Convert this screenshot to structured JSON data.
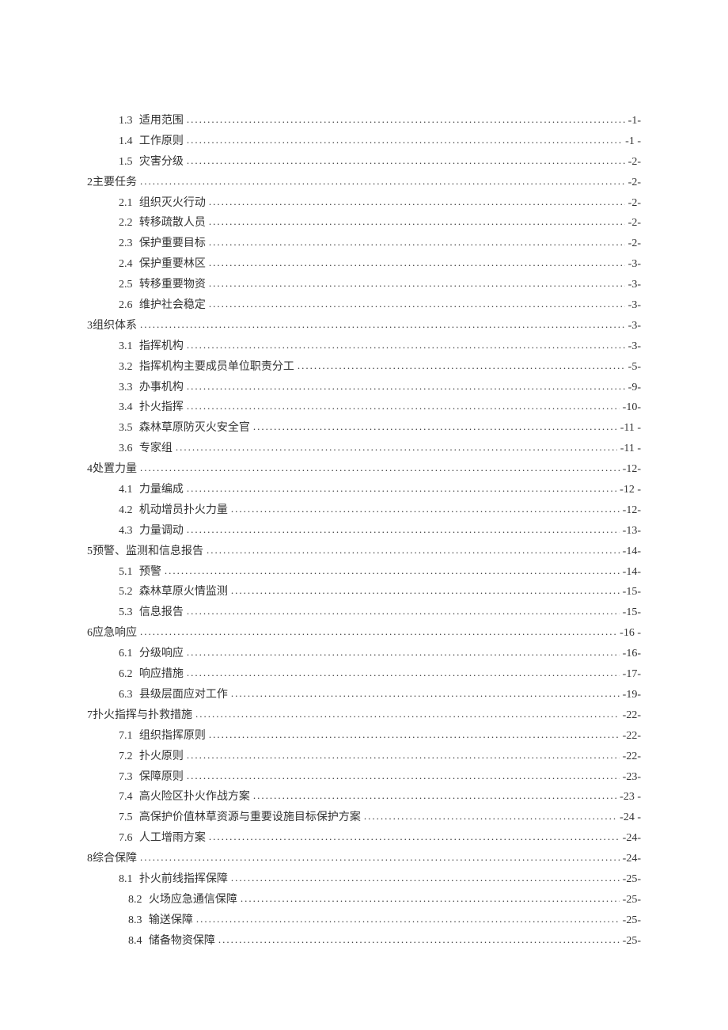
{
  "entries": [
    {
      "num": "1.3",
      "title": "适用范围",
      "page": "-1-",
      "indent": 1,
      "spaced": true
    },
    {
      "num": "1.4",
      "title": "工作原则",
      "page": "-1 -",
      "indent": 1,
      "spaced": true
    },
    {
      "num": "1.5",
      "title": "灾害分级",
      "page": "-2-",
      "indent": 1,
      "spaced": true
    },
    {
      "num": "2",
      "title": "主要任务",
      "page": "-2-",
      "indent": 0,
      "spaced": false
    },
    {
      "num": "2.1",
      "title": "组织灭火行动",
      "page": "-2-",
      "indent": 1,
      "spaced": true
    },
    {
      "num": "2.2",
      "title": "转移疏散人员",
      "page": "-2-",
      "indent": 1,
      "spaced": true
    },
    {
      "num": "2.3",
      "title": "保护重要目标",
      "page": "-2-",
      "indent": 1,
      "spaced": true
    },
    {
      "num": "2.4",
      "title": "保护重要林区",
      "page": "-3-",
      "indent": 1,
      "spaced": true
    },
    {
      "num": "2.5",
      "title": "转移重要物资",
      "page": "-3-",
      "indent": 1,
      "spaced": true
    },
    {
      "num": "2.6",
      "title": "维护社会稳定",
      "page": "-3-",
      "indent": 1,
      "spaced": true
    },
    {
      "num": "3",
      "title": "组织体系",
      "page": "-3-",
      "indent": 0,
      "spaced": false
    },
    {
      "num": "3.1",
      "title": "指挥机构",
      "page": "-3-",
      "indent": 1,
      "spaced": true
    },
    {
      "num": "3.2",
      "title": "指挥机构主要成员单位职责分工",
      "page": "-5-",
      "indent": 1,
      "spaced": true
    },
    {
      "num": "3.3",
      "title": "办事机构",
      "page": "-9-",
      "indent": 1,
      "spaced": true
    },
    {
      "num": "3.4",
      "title": "扑火指挥",
      "page": "-10-",
      "indent": 1,
      "spaced": true
    },
    {
      "num": "3.5",
      "title": "森林草原防灭火安全官",
      "page": "-11  -",
      "indent": 1,
      "spaced": true
    },
    {
      "num": "3.6",
      "title": "专家组",
      "page": "-11 -",
      "indent": 1,
      "spaced": true
    },
    {
      "num": "4",
      "title": "处置力量",
      "page": "-12-",
      "indent": 0,
      "spaced": false
    },
    {
      "num": "4.1",
      "title": "力量编成",
      "page": "-12 -",
      "indent": 1,
      "spaced": true
    },
    {
      "num": "4.2",
      "title": "机动增员扑火力量",
      "page": "-12-",
      "indent": 1,
      "spaced": true
    },
    {
      "num": "4.3",
      "title": "力量调动",
      "page": "-13-",
      "indent": 1,
      "spaced": true
    },
    {
      "num": "5",
      "title": "预警、监测和信息报告",
      "page": "-14-",
      "indent": 0,
      "spaced": false
    },
    {
      "num": "5.1",
      "title": "预警",
      "page": "-14-",
      "indent": 1,
      "spaced": true
    },
    {
      "num": "5.2",
      "title": "森林草原火情监测",
      "page": "-15-",
      "indent": 1,
      "spaced": true
    },
    {
      "num": "5.3",
      "title": "信息报告",
      "page": "-15-",
      "indent": 1,
      "spaced": true
    },
    {
      "num": "6",
      "title": "应急响应",
      "page": "-16 -",
      "indent": 0,
      "spaced": false
    },
    {
      "num": "6.1",
      "title": "分级响应",
      "page": "-16-",
      "indent": 1,
      "spaced": true
    },
    {
      "num": "6.2",
      "title": "响应措施",
      "page": "-17-",
      "indent": 1,
      "spaced": true
    },
    {
      "num": "6.3",
      "title": "县级层面应对工作",
      "page": "-19-",
      "indent": 1,
      "spaced": true
    },
    {
      "num": "7",
      "title": "扑火指挥与扑救措施",
      "page": "-22-",
      "indent": 0,
      "spaced": false
    },
    {
      "num": "7.1",
      "title": "组织指挥原则",
      "page": "-22-",
      "indent": 1,
      "spaced": true
    },
    {
      "num": "7.2",
      "title": "扑火原则",
      "page": "-22-",
      "indent": 1,
      "spaced": true
    },
    {
      "num": "7.3",
      "title": "保障原则",
      "page": "-23-",
      "indent": 1,
      "spaced": true
    },
    {
      "num": "7.4",
      "title": "高火险区扑火作战方案",
      "page": "-23 -",
      "indent": 1,
      "spaced": true
    },
    {
      "num": "7.5",
      "title": "高保护价值林草资源与重要设施目标保护方案",
      "page": "-24 -",
      "indent": 1,
      "spaced": true
    },
    {
      "num": "7.6",
      "title": "人工增雨方案",
      "page": "-24-",
      "indent": 1,
      "spaced": true
    },
    {
      "num": "8",
      "title": "综合保障",
      "page": "-24-",
      "indent": 0,
      "spaced": false
    },
    {
      "num": "8.1",
      "title": "扑火前线指挥保障",
      "page": "-25-",
      "indent": 1,
      "spaced": true
    },
    {
      "num": "8.2",
      "title": "火场应急通信保障",
      "page": "-25-",
      "indent": 2,
      "spaced": true
    },
    {
      "num": "8.3",
      "title": "输送保障",
      "page": "-25-",
      "indent": 2,
      "spaced": true
    },
    {
      "num": "8.4",
      "title": "储备物资保障",
      "page": "-25-",
      "indent": 2,
      "spaced": true
    }
  ]
}
